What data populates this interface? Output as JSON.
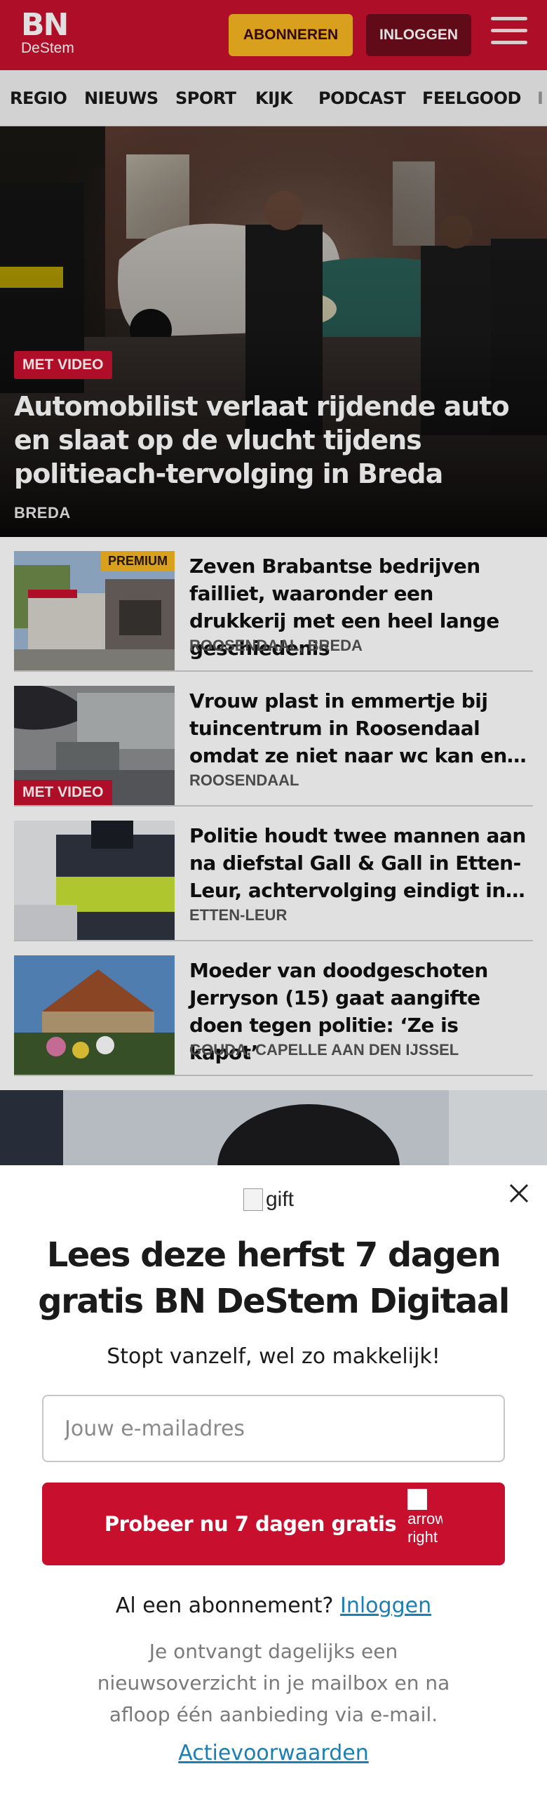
{
  "header": {
    "logo_top": "BN",
    "logo_bottom": "DeStem",
    "subscribe_label": "ABONNEREN",
    "login_label": "INLOGGEN",
    "brand_color": "#c8102e"
  },
  "nav": {
    "items": [
      "REGIO",
      "NIEUWS",
      "SPORT",
      "KIJK",
      "PODCAST",
      "FEELGOOD",
      "I"
    ]
  },
  "hero": {
    "badge": "MET VIDEO",
    "title": "Automobilist verlaat rijdende auto en slaat op de vlucht tijdens politieach-tervolging in Breda",
    "location": "BREDA"
  },
  "articles": [
    {
      "title": "Zeven Brabantse bedrijven failliet, waaronder een drukkerij met een heel lange geschiedenis",
      "location": "ROOSENDAAL, BREDA",
      "label": "PREMIUM"
    },
    {
      "title": "Vrouw plast in emmertje bij tuincentrum in Roosendaal omdat ze niet naar wc kan en…",
      "location": "ROOSENDAAL",
      "label": "MET VIDEO"
    },
    {
      "title": "Politie houdt twee mannen aan na diefstal Gall & Gall in Etten-Leur, achtervolging eindigt in…",
      "location": "ETTEN-LEUR"
    },
    {
      "title": "Moeder van doodgeschoten Jerryson (15) gaat aangifte doen tegen politie: ‘Ze is kapot’",
      "location": "GOUDA, CAPELLE AAN DEN IJSSEL"
    }
  ],
  "modal": {
    "gift_alt": "gift",
    "title": "Lees deze herfst 7 dagen gratis BN DeStem Digitaal",
    "subtitle": "Stopt vanzelf, wel zo makkelijk!",
    "email_placeholder": "Jouw e-mailadres",
    "cta_label": "Probeer nu 7 dagen gratis",
    "cta_icon_alt": "arrow-right",
    "have_subscription": "Al een abonnement?",
    "login_link": "Inloggen",
    "info": "Je ontvangt dagelijks een nieuwsoverzicht in je mailbox en na afloop één aanbieding via e-mail.",
    "terms_link": "Actievoorwaarden"
  }
}
